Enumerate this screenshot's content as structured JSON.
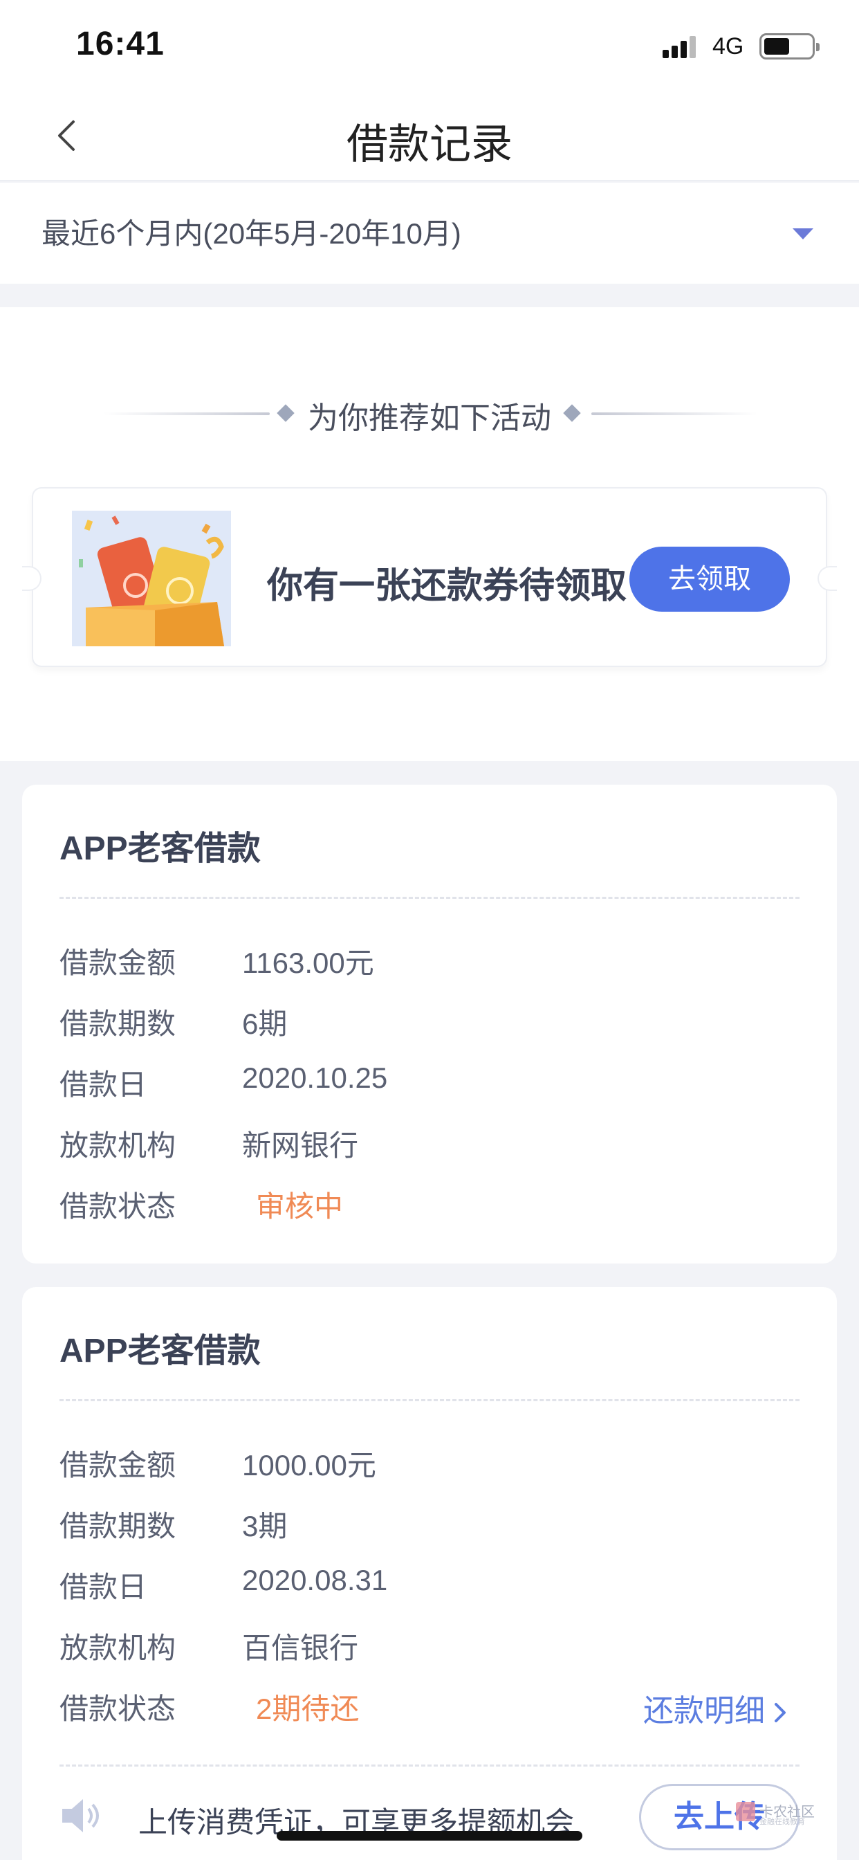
{
  "status_bar": {
    "time": "16:41",
    "network": "4G"
  },
  "nav": {
    "title": "借款记录"
  },
  "filter": {
    "label": "最近6个月内(20年5月-20年10月)"
  },
  "promo": {
    "heading": "为你推荐如下活动",
    "coupon_text": "你有一张还款券待领取",
    "coupon_button": "去领取"
  },
  "loans": [
    {
      "title": "APP老客借款",
      "rows": [
        {
          "label": "借款金额",
          "value": "1163.00元"
        },
        {
          "label": "借款期数",
          "value": "6期"
        },
        {
          "label": "借款日",
          "value": "2020.10.25"
        },
        {
          "label": "放款机构",
          "value": "新网银行"
        },
        {
          "label": "借款状态",
          "value": "审核中"
        }
      ]
    },
    {
      "title": "APP老客借款",
      "rows": [
        {
          "label": "借款金额",
          "value": "1000.00元"
        },
        {
          "label": "借款期数",
          "value": "3期"
        },
        {
          "label": "借款日",
          "value": "2020.08.31"
        },
        {
          "label": "放款机构",
          "value": "百信银行"
        },
        {
          "label": "借款状态",
          "value": "2期待还"
        }
      ],
      "detail_link": "还款明细",
      "upload_text": "上传消费凭证，可享更多提额机会",
      "upload_button": "去上传"
    }
  ],
  "watermark": {
    "text": "卡农社区",
    "sub": "金融在线教育"
  },
  "colors": {
    "accent": "#4e73e8",
    "status": "#f08a55",
    "link": "#5b7de0"
  }
}
